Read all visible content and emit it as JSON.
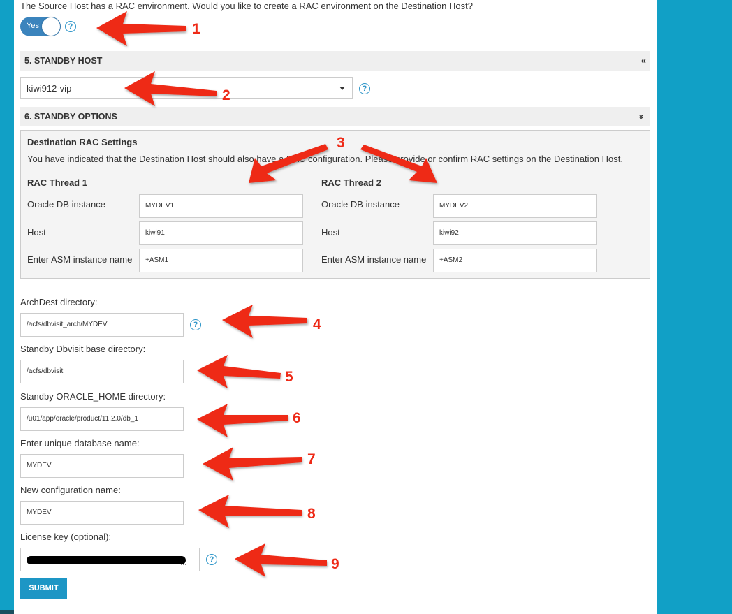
{
  "rac_question": "The Source Host has a RAC environment. Would you like to create a RAC environment on the Destination Host?",
  "rac_toggle": {
    "label": "Yes",
    "on": true
  },
  "standby_host": {
    "section_title": "5. STANDBY HOST",
    "selected": "kiwi912-vip",
    "chevron": "«"
  },
  "standby_options": {
    "section_title": "6. STANDBY OPTIONS",
    "chevron": "»",
    "rac_settings": {
      "title": "Destination RAC Settings",
      "description": "You have indicated that the Destination Host should also have a RAC configuration. Please provide or confirm RAC settings on the Destination Host.",
      "threads": [
        {
          "title": "RAC Thread 1",
          "db_instance_label": "Oracle DB instance",
          "db_instance": "MYDEV1",
          "host_label": "Host",
          "host": "kiwi91",
          "asm_label": "Enter ASM instance name",
          "asm": "+ASM1"
        },
        {
          "title": "RAC Thread 2",
          "db_instance_label": "Oracle DB instance",
          "db_instance": "MYDEV2",
          "host_label": "Host",
          "host": "kiwi92",
          "asm_label": "Enter ASM instance name",
          "asm": "+ASM2"
        }
      ]
    },
    "fields": {
      "archdest": {
        "label": "ArchDest directory:",
        "value": "/acfs/dbvisit_arch/MYDEV"
      },
      "dbvisit_base": {
        "label": "Standby Dbvisit base directory:",
        "value": "/acfs/dbvisit"
      },
      "oracle_home": {
        "label": "Standby ORACLE_HOME directory:",
        "value": "/u01/app/oracle/product/11.2.0/db_1"
      },
      "unique_db_name": {
        "label": "Enter unique database name:",
        "value": "MYDEV"
      },
      "config_name": {
        "label": "New configuration name:",
        "value": "MYDEV"
      },
      "license_key": {
        "label": "License key (optional):",
        "visible_tail": "···"
      }
    },
    "submit_label": "SUBMIT"
  },
  "help_icon_glyph": "?",
  "annotations": [
    "1",
    "2",
    "3",
    "4",
    "5",
    "6",
    "7",
    "8",
    "9"
  ],
  "colors": {
    "accent": "#1d96c5",
    "toggle": "#3b84bd",
    "background": "#11a0c6",
    "annotation": "#ee2a17"
  }
}
